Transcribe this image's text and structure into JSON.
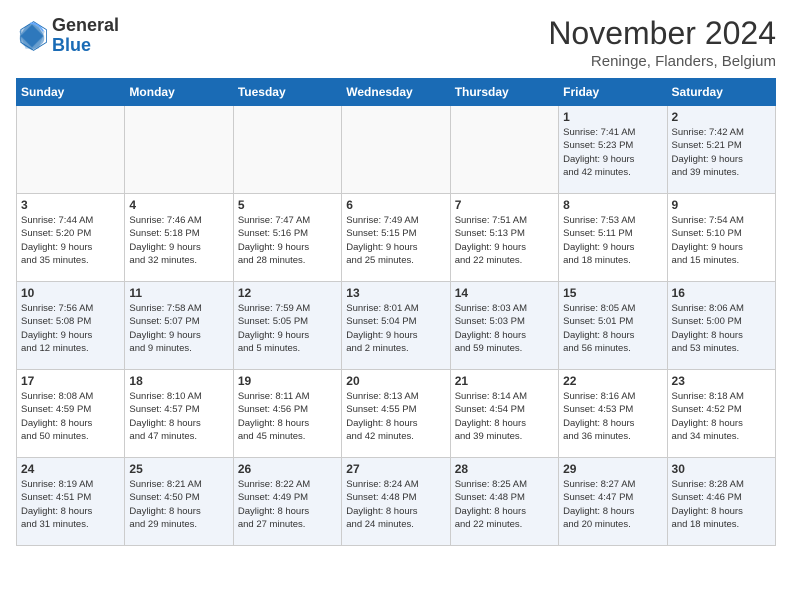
{
  "logo": {
    "line1": "General",
    "line2": "Blue"
  },
  "title": "November 2024",
  "location": "Reninge, Flanders, Belgium",
  "weekdays": [
    "Sunday",
    "Monday",
    "Tuesday",
    "Wednesday",
    "Thursday",
    "Friday",
    "Saturday"
  ],
  "weeks": [
    [
      {
        "day": "",
        "info": ""
      },
      {
        "day": "",
        "info": ""
      },
      {
        "day": "",
        "info": ""
      },
      {
        "day": "",
        "info": ""
      },
      {
        "day": "",
        "info": ""
      },
      {
        "day": "1",
        "info": "Sunrise: 7:41 AM\nSunset: 5:23 PM\nDaylight: 9 hours\nand 42 minutes."
      },
      {
        "day": "2",
        "info": "Sunrise: 7:42 AM\nSunset: 5:21 PM\nDaylight: 9 hours\nand 39 minutes."
      }
    ],
    [
      {
        "day": "3",
        "info": "Sunrise: 7:44 AM\nSunset: 5:20 PM\nDaylight: 9 hours\nand 35 minutes."
      },
      {
        "day": "4",
        "info": "Sunrise: 7:46 AM\nSunset: 5:18 PM\nDaylight: 9 hours\nand 32 minutes."
      },
      {
        "day": "5",
        "info": "Sunrise: 7:47 AM\nSunset: 5:16 PM\nDaylight: 9 hours\nand 28 minutes."
      },
      {
        "day": "6",
        "info": "Sunrise: 7:49 AM\nSunset: 5:15 PM\nDaylight: 9 hours\nand 25 minutes."
      },
      {
        "day": "7",
        "info": "Sunrise: 7:51 AM\nSunset: 5:13 PM\nDaylight: 9 hours\nand 22 minutes."
      },
      {
        "day": "8",
        "info": "Sunrise: 7:53 AM\nSunset: 5:11 PM\nDaylight: 9 hours\nand 18 minutes."
      },
      {
        "day": "9",
        "info": "Sunrise: 7:54 AM\nSunset: 5:10 PM\nDaylight: 9 hours\nand 15 minutes."
      }
    ],
    [
      {
        "day": "10",
        "info": "Sunrise: 7:56 AM\nSunset: 5:08 PM\nDaylight: 9 hours\nand 12 minutes."
      },
      {
        "day": "11",
        "info": "Sunrise: 7:58 AM\nSunset: 5:07 PM\nDaylight: 9 hours\nand 9 minutes."
      },
      {
        "day": "12",
        "info": "Sunrise: 7:59 AM\nSunset: 5:05 PM\nDaylight: 9 hours\nand 5 minutes."
      },
      {
        "day": "13",
        "info": "Sunrise: 8:01 AM\nSunset: 5:04 PM\nDaylight: 9 hours\nand 2 minutes."
      },
      {
        "day": "14",
        "info": "Sunrise: 8:03 AM\nSunset: 5:03 PM\nDaylight: 8 hours\nand 59 minutes."
      },
      {
        "day": "15",
        "info": "Sunrise: 8:05 AM\nSunset: 5:01 PM\nDaylight: 8 hours\nand 56 minutes."
      },
      {
        "day": "16",
        "info": "Sunrise: 8:06 AM\nSunset: 5:00 PM\nDaylight: 8 hours\nand 53 minutes."
      }
    ],
    [
      {
        "day": "17",
        "info": "Sunrise: 8:08 AM\nSunset: 4:59 PM\nDaylight: 8 hours\nand 50 minutes."
      },
      {
        "day": "18",
        "info": "Sunrise: 8:10 AM\nSunset: 4:57 PM\nDaylight: 8 hours\nand 47 minutes."
      },
      {
        "day": "19",
        "info": "Sunrise: 8:11 AM\nSunset: 4:56 PM\nDaylight: 8 hours\nand 45 minutes."
      },
      {
        "day": "20",
        "info": "Sunrise: 8:13 AM\nSunset: 4:55 PM\nDaylight: 8 hours\nand 42 minutes."
      },
      {
        "day": "21",
        "info": "Sunrise: 8:14 AM\nSunset: 4:54 PM\nDaylight: 8 hours\nand 39 minutes."
      },
      {
        "day": "22",
        "info": "Sunrise: 8:16 AM\nSunset: 4:53 PM\nDaylight: 8 hours\nand 36 minutes."
      },
      {
        "day": "23",
        "info": "Sunrise: 8:18 AM\nSunset: 4:52 PM\nDaylight: 8 hours\nand 34 minutes."
      }
    ],
    [
      {
        "day": "24",
        "info": "Sunrise: 8:19 AM\nSunset: 4:51 PM\nDaylight: 8 hours\nand 31 minutes."
      },
      {
        "day": "25",
        "info": "Sunrise: 8:21 AM\nSunset: 4:50 PM\nDaylight: 8 hours\nand 29 minutes."
      },
      {
        "day": "26",
        "info": "Sunrise: 8:22 AM\nSunset: 4:49 PM\nDaylight: 8 hours\nand 27 minutes."
      },
      {
        "day": "27",
        "info": "Sunrise: 8:24 AM\nSunset: 4:48 PM\nDaylight: 8 hours\nand 24 minutes."
      },
      {
        "day": "28",
        "info": "Sunrise: 8:25 AM\nSunset: 4:48 PM\nDaylight: 8 hours\nand 22 minutes."
      },
      {
        "day": "29",
        "info": "Sunrise: 8:27 AM\nSunset: 4:47 PM\nDaylight: 8 hours\nand 20 minutes."
      },
      {
        "day": "30",
        "info": "Sunrise: 8:28 AM\nSunset: 4:46 PM\nDaylight: 8 hours\nand 18 minutes."
      }
    ]
  ]
}
